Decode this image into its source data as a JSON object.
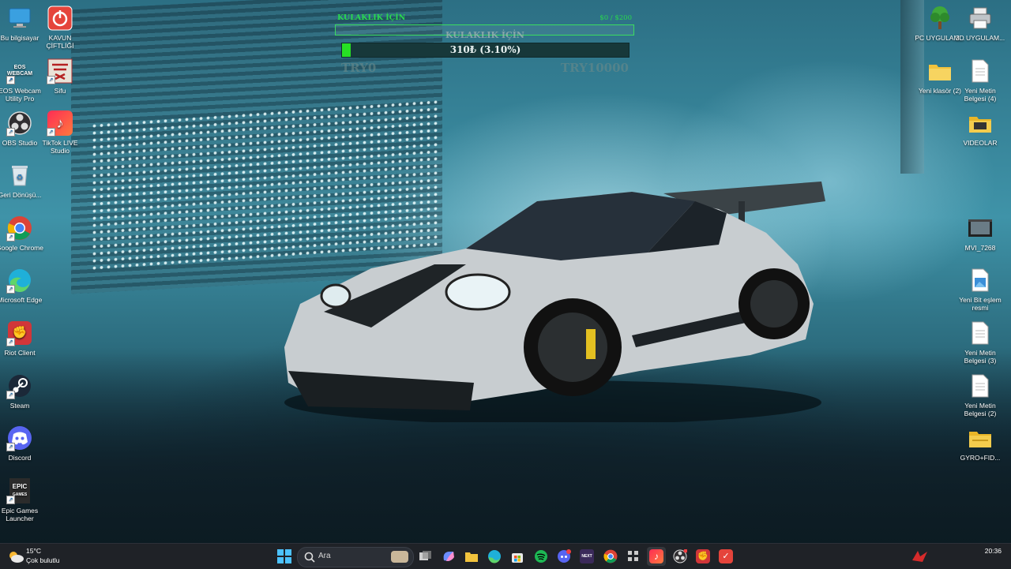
{
  "desktop_left": [
    {
      "label": "Bu bilgisayar"
    },
    {
      "label": "EOS Webcam Utility Pro",
      "logo_text_1": "EOS",
      "logo_text_2": "WEBCAM"
    },
    {
      "label": "OBS Studio"
    },
    {
      "label": "Geri Dönüşü..."
    },
    {
      "label": "Google Chrome"
    },
    {
      "label": "Microsoft Edge"
    },
    {
      "label": "Riot Client"
    },
    {
      "label": "Steam"
    },
    {
      "label": "Discord"
    },
    {
      "label": "Epic Games Launcher",
      "logo_text_1": "EPIC",
      "logo_text_2": "GAMES"
    }
  ],
  "desktop_left2": [
    {
      "label": "KAVUN ÇİFTLİĞİ"
    },
    {
      "label": "Sifu"
    },
    {
      "label": "TikTok LIVE Studio"
    }
  ],
  "desktop_right": [
    {
      "label": "PC UYGULAM..."
    },
    {
      "label": "3D UYGULAM..."
    },
    {
      "label": "Yeni klasör (2)"
    },
    {
      "label": "Yeni Metin Belgesi (4)"
    },
    {
      "label": "VIDEOLAR"
    },
    {
      "label": "MVI_7268"
    },
    {
      "label": "Yeni Bit eşlem resmi"
    },
    {
      "label": "Yeni Metin Belgesi (3)"
    },
    {
      "label": "Yeni Metin Belgesi (2)"
    },
    {
      "label": "GYRO+FID..."
    }
  ],
  "donation_widget": {
    "title": "KULAKLIK İÇİN",
    "amount": "$0 / $200",
    "title_overlay": "KULAKLIK İÇİN",
    "progress_text": "310₺ (3.10%)",
    "progress_percent": 3.1,
    "min_label": "TRY0",
    "max_label": "TRY10000"
  },
  "taskbar": {
    "search_placeholder": "Ara",
    "weather_temp": "15°C",
    "weather_desc": "Çok bulutlu",
    "time": "20:36",
    "apps": [
      "start",
      "search",
      "task-view",
      "copilot",
      "file-explorer",
      "edge",
      "store",
      "spotify",
      "discord",
      "next",
      "chrome",
      "app-grid",
      "tiktok-live",
      "obs",
      "riot",
      "kavun"
    ]
  },
  "colors": {
    "accent_green": "#29d94d",
    "taskbar_bg": "#16191e",
    "chrome_red": "#db4437"
  }
}
